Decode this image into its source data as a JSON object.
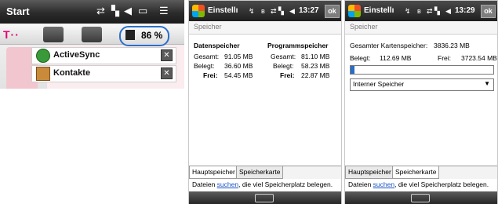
{
  "panel1": {
    "title": "Start",
    "carrier_logo": "T··",
    "battery_percent": "86 %",
    "notifications": [
      {
        "label": "ActiveSync",
        "icon": "activesync-icon"
      },
      {
        "label": "Kontakte",
        "icon": "contacts-icon"
      }
    ]
  },
  "panel2": {
    "title": "Einstellı",
    "time": "13:27",
    "ok": "ok",
    "subtitle": "Speicher",
    "data_header": "Datenspeicher",
    "prog_header": "Programmspeicher",
    "rows": [
      {
        "label": "Gesamt:",
        "data": "91.05 MB",
        "prog_label": "Gesamt:",
        "prog": "81.10 MB"
      },
      {
        "label": "Belegt:",
        "data": "36.60 MB",
        "prog_label": "Belegt:",
        "prog": "58.23 MB"
      },
      {
        "label": "Frei:",
        "data": "54.45 MB",
        "prog_label": "Frei:",
        "prog": "22.87 MB"
      }
    ],
    "tabs": [
      "Hauptspeicher",
      "Speicherkarte"
    ],
    "active_tab": 0,
    "footer_pre": "Dateien ",
    "footer_link": "suchen",
    "footer_post": ", die viel Speicherplatz belegen."
  },
  "panel3": {
    "title": "Einstellı",
    "time": "13:29",
    "ok": "ok",
    "subtitle": "Speicher",
    "total_label": "Gesamter Kartenspeicher:",
    "total_value": "3836.23 MB",
    "used_label": "Belegt:",
    "used_value": "112.69 MB",
    "free_label": "Frei:",
    "free_value": "3723.54 MB",
    "usage_fraction": 0.03,
    "select_value": "Interner Speicher",
    "tabs": [
      "Hauptspeicher",
      "Speicherkarte"
    ],
    "active_tab": 1,
    "footer_pre": "Dateien ",
    "footer_link": "suchen",
    "footer_post": ", die viel Speicherplatz belegen."
  },
  "colors": {
    "accent": "#2a6fc9",
    "brand": "#e20074",
    "link": "#1b55c5"
  }
}
